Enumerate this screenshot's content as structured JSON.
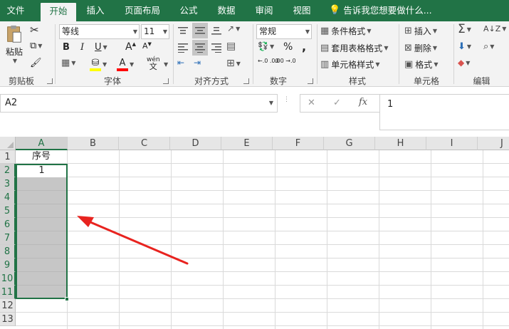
{
  "tabs": [
    "文件",
    "开始",
    "插入",
    "页面布局",
    "公式",
    "数据",
    "审阅",
    "视图"
  ],
  "tell_me": "告诉我您想要做什么...",
  "clipboard": {
    "paste": "粘贴",
    "label": "剪贴板"
  },
  "font": {
    "name": "等线",
    "size": "11",
    "bold": "B",
    "italic": "I",
    "underline": "U",
    "grow": "A",
    "shrink": "A",
    "phonetic": "wén",
    "label": "字体"
  },
  "alignment": {
    "label": "对齐方式"
  },
  "number": {
    "format": "常规",
    "percent": "%",
    "comma": ",",
    "inc_dec": "←.0 .00",
    "dec_dec": ".00 →.0",
    "label": "数字"
  },
  "styles": {
    "conditional": "条件格式",
    "table": "套用表格格式",
    "cell": "单元格样式",
    "label": "样式"
  },
  "cells": {
    "insert": "插入",
    "delete": "删除",
    "format": "格式",
    "label": "单元格"
  },
  "editing": {
    "label": "编辑"
  },
  "formula_bar": {
    "name_box": "A2",
    "fx": "fx",
    "cancel": "✕",
    "enter": "✓",
    "content": "1"
  },
  "columns": [
    "A",
    "B",
    "C",
    "D",
    "E",
    "F",
    "G",
    "H",
    "I",
    "J"
  ],
  "rows": [
    "1",
    "2",
    "3",
    "4",
    "5",
    "6",
    "7",
    "8",
    "9",
    "10",
    "11",
    "12",
    "13"
  ],
  "cells_data": {
    "A1": "序号",
    "A2": "1"
  },
  "colors": {
    "brand": "#217346",
    "fill_yellow": "#ffff00",
    "font_red": "#ff0000",
    "selection": "#c6c6c6",
    "arrow": "#e8231f"
  }
}
